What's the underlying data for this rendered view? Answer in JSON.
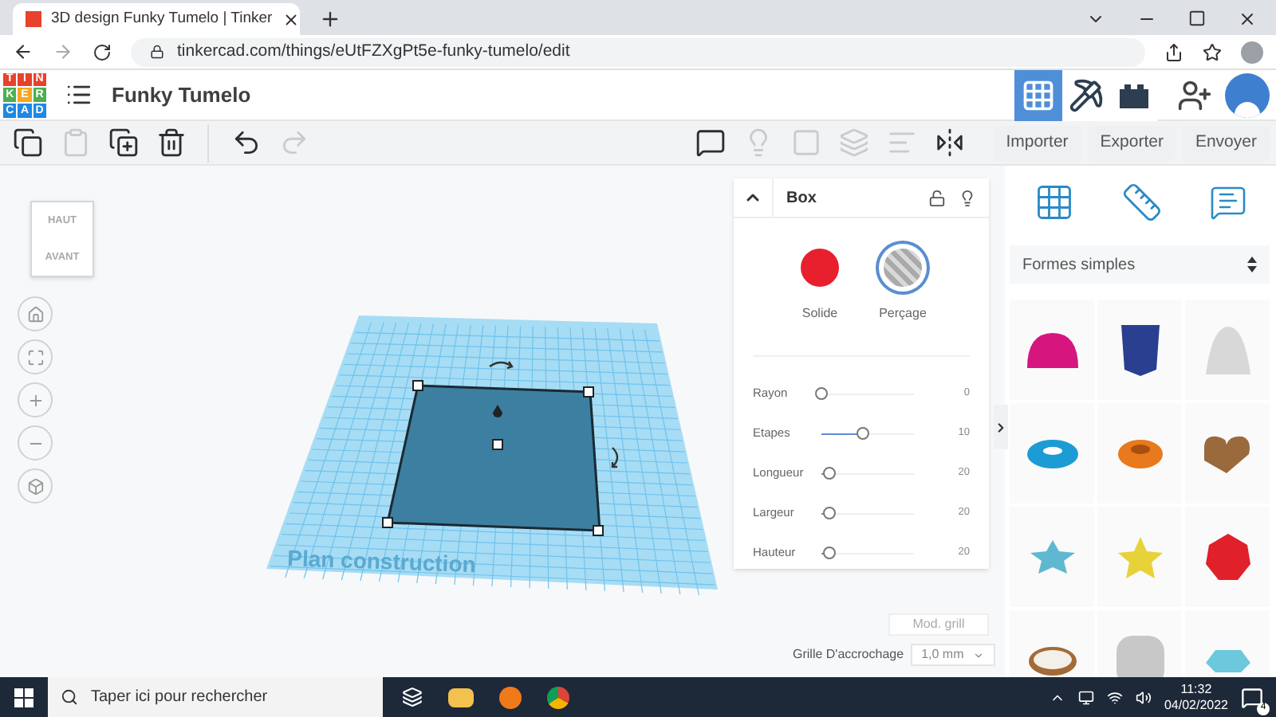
{
  "browser": {
    "tab_title": "3D design Funky Tumelo | Tinker",
    "url": "tinkercad.com/things/eUtFZXgPt5e-funky-tumelo/edit"
  },
  "header": {
    "logo_letters": [
      {
        "text": "T",
        "color": "#e8412c"
      },
      {
        "text": "I",
        "color": "#e8412c"
      },
      {
        "text": "N",
        "color": "#e8412c"
      },
      {
        "text": "K",
        "color": "#4caf50"
      },
      {
        "text": "E",
        "color": "#f5a623"
      },
      {
        "text": "R",
        "color": "#4caf50"
      },
      {
        "text": "C",
        "color": "#1e88e5"
      },
      {
        "text": "A",
        "color": "#1e88e5"
      },
      {
        "text": "D",
        "color": "#1e88e5"
      }
    ],
    "title": "Funky Tumelo",
    "views": [
      {
        "kind": "grid",
        "selected": true
      },
      {
        "kind": "pickaxe",
        "selected": false
      },
      {
        "kind": "brick",
        "selected": false
      }
    ]
  },
  "toolbar": {
    "left": [
      {
        "kind": "copy",
        "disabled": false
      },
      {
        "kind": "paste",
        "disabled": true
      },
      {
        "kind": "duplicate",
        "disabled": false
      },
      {
        "kind": "delete",
        "disabled": false
      },
      {
        "kind": "undo",
        "disabled": false
      },
      {
        "kind": "redo",
        "disabled": true
      }
    ],
    "right": [
      {
        "kind": "note",
        "disabled": false
      },
      {
        "kind": "bulb",
        "disabled": true
      },
      {
        "kind": "group",
        "disabled": true
      },
      {
        "kind": "ungroup",
        "disabled": true
      },
      {
        "kind": "align",
        "disabled": true
      },
      {
        "kind": "mirror",
        "disabled": false
      }
    ],
    "buttons": [
      "Importer",
      "Exporter",
      "Envoyer"
    ]
  },
  "view_cube": {
    "top": "HAUT",
    "front": "AVANT"
  },
  "workplane": {
    "label": "Plan construction"
  },
  "inspector": {
    "title": "Box",
    "modes": [
      {
        "label": "Solide",
        "kind": "solid",
        "selected": false
      },
      {
        "label": "Perçage",
        "kind": "hole",
        "selected": true
      }
    ],
    "params": [
      {
        "name": "Rayon",
        "level": 0,
        "reading": "0"
      },
      {
        "name": "Etapes",
        "level": 0.45,
        "reading": "10"
      },
      {
        "name": "Longueur",
        "level": 0.08,
        "reading": "20"
      },
      {
        "name": "Largeur",
        "level": 0.08,
        "reading": "20"
      },
      {
        "name": "Hauteur",
        "level": 0.08,
        "reading": "20"
      }
    ]
  },
  "grid_settings": {
    "edit_button": "Mod. grill",
    "snap_label": "Grille D'accrochage",
    "snap_value": "1,0 mm"
  },
  "library": {
    "category": "Formes simples",
    "shapes": [
      {
        "kind": "dome",
        "color": "#d6157f"
      },
      {
        "kind": "prism",
        "color": "#2a3f8f"
      },
      {
        "kind": "paraboloid",
        "color": "#d8d8d8"
      },
      {
        "kind": "torus",
        "color": "#1d9bd4"
      },
      {
        "kind": "tube",
        "color": "#e8791c"
      },
      {
        "kind": "heart",
        "color": "#9a6a3c"
      },
      {
        "kind": "star",
        "color": "#5fb8d0"
      },
      {
        "kind": "star3d",
        "color": "#e8d23a"
      },
      {
        "kind": "polyhedron",
        "color": "#e0202a"
      },
      {
        "kind": "ring",
        "color": "#a36a38"
      },
      {
        "kind": "rounded_box",
        "color": "#c8c8c8"
      },
      {
        "kind": "gem",
        "color": "#6cc8dc"
      }
    ]
  },
  "taskbar": {
    "search_placeholder": "Taper ici pour rechercher",
    "time": "11:32",
    "date": "04/02/2022",
    "notifications": "4"
  }
}
